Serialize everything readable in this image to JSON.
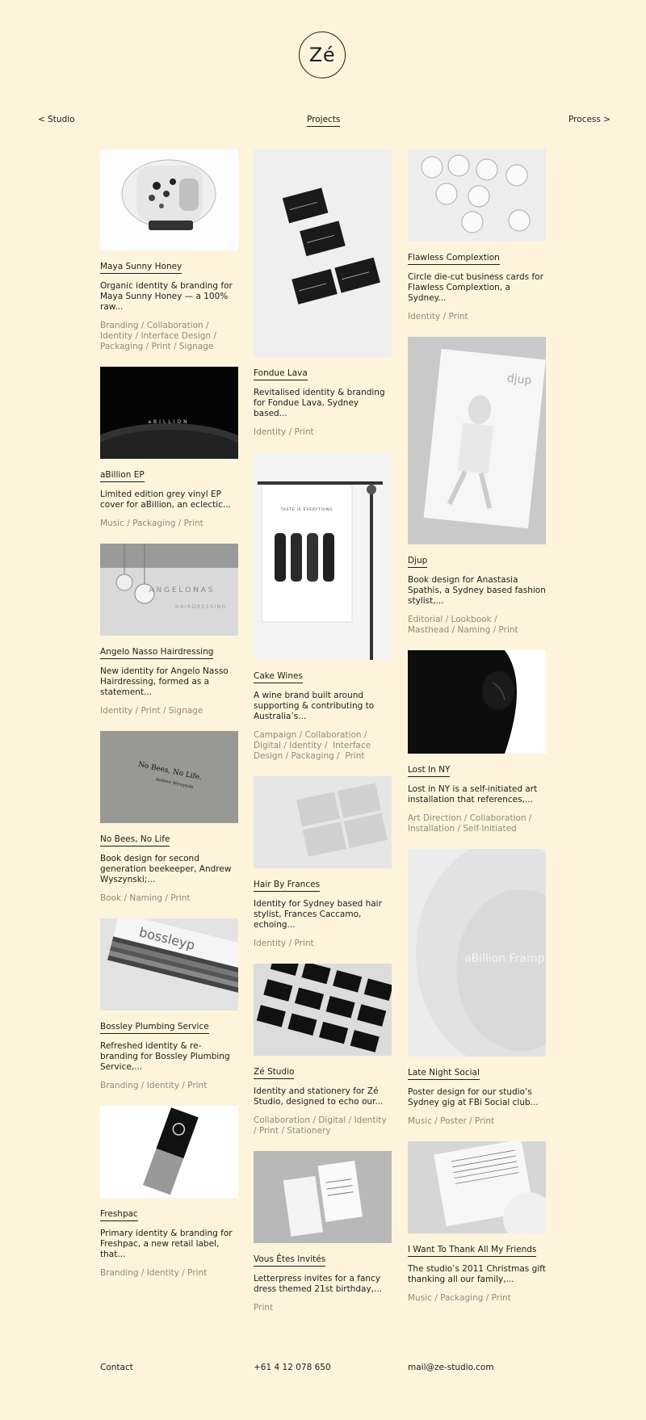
{
  "brand": {
    "logo_text": "Zé"
  },
  "nav": {
    "prev": "< Studio",
    "current": "Projects",
    "next": "Process >"
  },
  "projects": [
    {
      "title": "Maya Sunny Honey",
      "desc": "Organic identity & branding for Maya Sunny Honey — a 100% raw...",
      "tags": "Branding / Collaboration /  Identity / Interface Design /  Packaging / Print / Signage"
    },
    {
      "title": "aBillion EP",
      "desc": "Limited edition grey vinyl EP cover for aBillion, an eclectic...",
      "tags": "Music / Packaging / Print",
      "image_text": "aBILLION"
    },
    {
      "title": "Angelo Nasso Hairdressing",
      "desc": "New identity for Angelo Nasso Hairdressing, formed as a statement...",
      "tags": "Identity / Print / Signage",
      "image_text_1": "A N G E L O   N A S",
      "image_text_2": "HAIRDRESSING"
    },
    {
      "title": "No Bees, No Life",
      "desc": "Book design for second generation beekeeper, Andrew Wyszynski;...",
      "tags": "Book / Naming / Print",
      "image_text_1": "No Bees, No Life.",
      "image_text_2": "Andrew Wyszynski"
    },
    {
      "title": "Bossley Plumbing Service",
      "desc": "Refreshed identity & re-branding for Bossley Plumbing Service,...",
      "tags": "Branding / Identity / Print",
      "image_text": "bossleyp"
    },
    {
      "title": "Freshpac",
      "desc": "Primary identity & branding for Freshpac, a new retail label, that...",
      "tags": "Branding / Identity / Print"
    },
    {
      "title": "Fondue Lava",
      "desc": "Revitalised identity & branding for Fondue Lava, Sydney based...",
      "tags": "Identity / Print"
    },
    {
      "title": "Cake Wines",
      "desc": "A wine brand built around supporting & contributing to Australia’s...",
      "tags": "Campaign / Collaboration /  Digital / Identity /  Interface Design / Packaging /  Print",
      "image_text": "TASTE IS EVERYTHING"
    },
    {
      "title": "Hair By Frances",
      "desc": "Identity for Sydney based hair stylist, Frances Caccamo, echoing...",
      "tags": "Identity / Print"
    },
    {
      "title": "Zé Studio",
      "desc": "Identity and stationery for Zé Studio, designed to echo our...",
      "tags": "Collaboration / Digital / Identity  / Print / Stationery"
    },
    {
      "title": "Vous Êtes Invités",
      "desc": "Letterpress invites for a fancy dress themed 21st birthday,...",
      "tags": "Print"
    },
    {
      "title": "Flawless Complextion",
      "desc": "Circle die-cut business cards for Flawless Complextion, a Sydney...",
      "tags": "Identity / Print"
    },
    {
      "title": "Djup",
      "desc": "Book design for Anastasia Spathis, a Sydney based fashion stylist,...",
      "tags": "Editorial / Lookbook /  Masthead / Naming / Print",
      "image_text": "djup"
    },
    {
      "title": "Lost In NY",
      "desc": "Lost in NY is a self-initiated art installation that references,...",
      "tags": "Art Direction / Collaboration /  Installation / Self-Initiated"
    },
    {
      "title": "Late Night Social",
      "desc": "Poster design for our studio’s Sydney gig at FBi Social club...",
      "tags": "Music / Poster / Print",
      "image_text": "aBillion Framps Zé"
    },
    {
      "title": "I Want To Thank All My Friends",
      "desc": "The studio’s 2011 Christmas gift thanking all our family,...",
      "tags": "Music / Packaging / Print"
    }
  ],
  "footer": {
    "contact": "Contact",
    "phone": "+61 4 12 078 650",
    "email": "mail@ze-studio.com"
  }
}
